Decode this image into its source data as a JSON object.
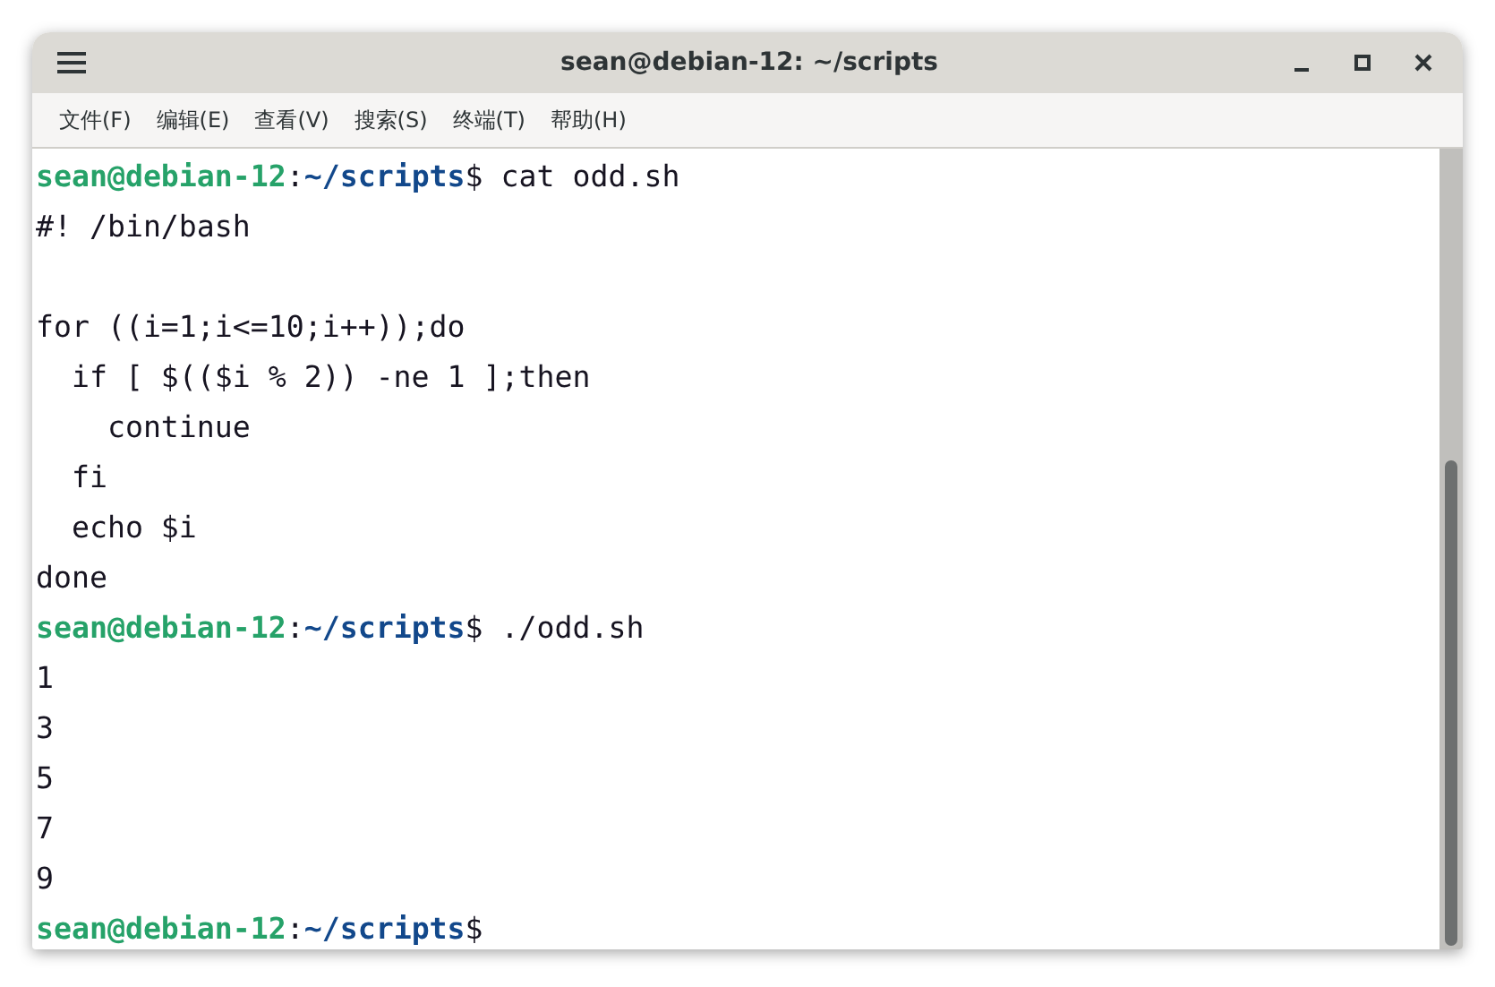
{
  "window": {
    "title": "sean@debian-12: ~/scripts",
    "controls": [
      {
        "kind": "minimize"
      },
      {
        "kind": "maximize"
      },
      {
        "kind": "close"
      }
    ]
  },
  "menu": [
    "文件(F)",
    "编辑(E)",
    "查看(V)",
    "搜索(S)",
    "终端(T)",
    "帮助(H)"
  ],
  "terminal": {
    "lines": [
      {
        "kind": "prompt",
        "user": "sean@debian-12",
        "sep": ":",
        "path": "~/scripts",
        "dollar": "$",
        "command": "cat odd.sh"
      },
      {
        "kind": "output",
        "text": "#! /bin/bash"
      },
      {
        "kind": "blank"
      },
      {
        "kind": "output",
        "text": "for ((i=1;i<=10;i++));do"
      },
      {
        "kind": "output",
        "text": "  if [ $(($i % 2)) -ne 1 ];then"
      },
      {
        "kind": "output",
        "text": "    continue"
      },
      {
        "kind": "output",
        "text": "  fi"
      },
      {
        "kind": "output",
        "text": "  echo $i"
      },
      {
        "kind": "output",
        "text": "done"
      },
      {
        "kind": "prompt",
        "user": "sean@debian-12",
        "sep": ":",
        "path": "~/scripts",
        "dollar": "$",
        "command": "./odd.sh"
      },
      {
        "kind": "output",
        "text": "1"
      },
      {
        "kind": "output",
        "text": "3"
      },
      {
        "kind": "output",
        "text": "5"
      },
      {
        "kind": "output",
        "text": "7"
      },
      {
        "kind": "output",
        "text": "9"
      },
      {
        "kind": "prompt",
        "user": "sean@debian-12",
        "sep": ":",
        "path": "~/scripts",
        "dollar": "$"
      }
    ]
  }
}
